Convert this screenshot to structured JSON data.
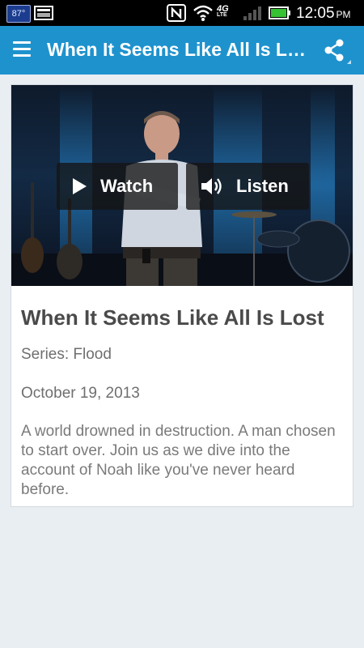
{
  "status_bar": {
    "temperature": "87°",
    "network": "4G",
    "network_sub": "LTE",
    "time": "12:05",
    "ampm": "PM"
  },
  "app_bar": {
    "title": "When It Seems Like All Is Lost",
    "menu_icon": "hamburger-menu-icon",
    "share_icon": "share-icon",
    "color": "#1e92cd"
  },
  "media": {
    "watch_label": "Watch",
    "listen_label": "Listen",
    "watch_icon": "play-icon",
    "listen_icon": "speaker-icon"
  },
  "sermon": {
    "title": "When It Seems Like All Is Lost",
    "series": "Series: Flood",
    "date": "October 19, 2013",
    "description": "A world drowned in destruction. A man chosen to start over. Join us as we dive into the account of Noah like you've never heard before."
  }
}
